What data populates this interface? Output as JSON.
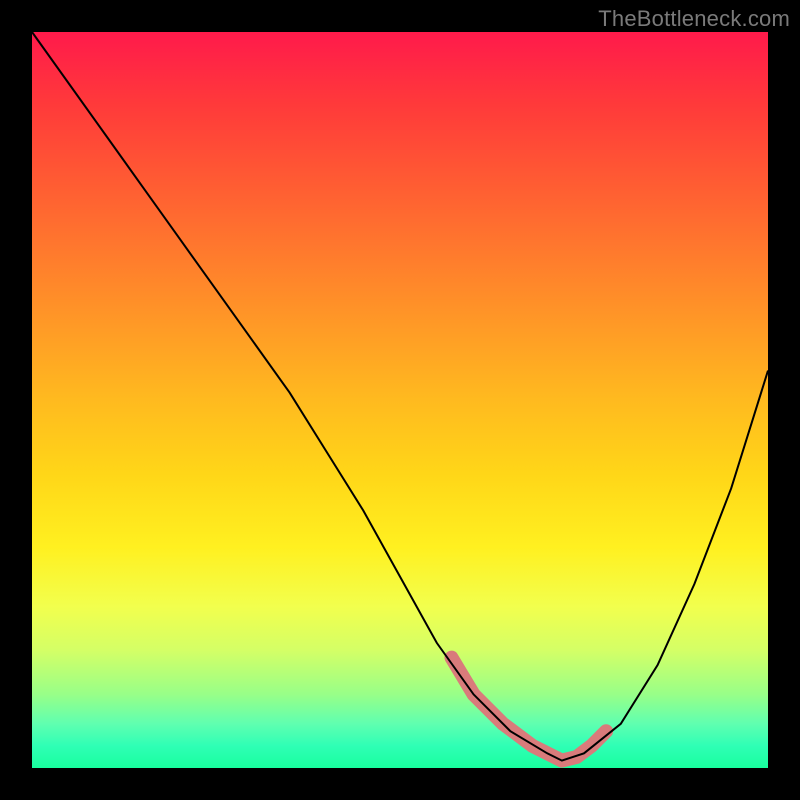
{
  "watermark": "TheBottleneck.com",
  "chart_data": {
    "type": "line",
    "title": "",
    "xlabel": "",
    "ylabel": "",
    "xlim": [
      0,
      100
    ],
    "ylim": [
      0,
      100
    ],
    "grid": false,
    "legend": false,
    "series": [
      {
        "name": "bottleneck-curve",
        "x": [
          0,
          5,
          10,
          15,
          20,
          25,
          30,
          35,
          40,
          45,
          50,
          55,
          60,
          65,
          70,
          72,
          75,
          80,
          85,
          90,
          95,
          100
        ],
        "values": [
          100,
          93,
          86,
          79,
          72,
          65,
          58,
          51,
          43,
          35,
          26,
          17,
          10,
          5,
          2,
          1,
          2,
          6,
          14,
          25,
          38,
          54
        ],
        "color": "#000000"
      },
      {
        "name": "optimal-range-highlight",
        "x": [
          57,
          60,
          64,
          68,
          72,
          74,
          76,
          78
        ],
        "values": [
          15,
          10,
          6,
          3,
          1,
          1.5,
          3,
          5
        ],
        "color": "#d97b7b"
      }
    ],
    "annotations": []
  }
}
